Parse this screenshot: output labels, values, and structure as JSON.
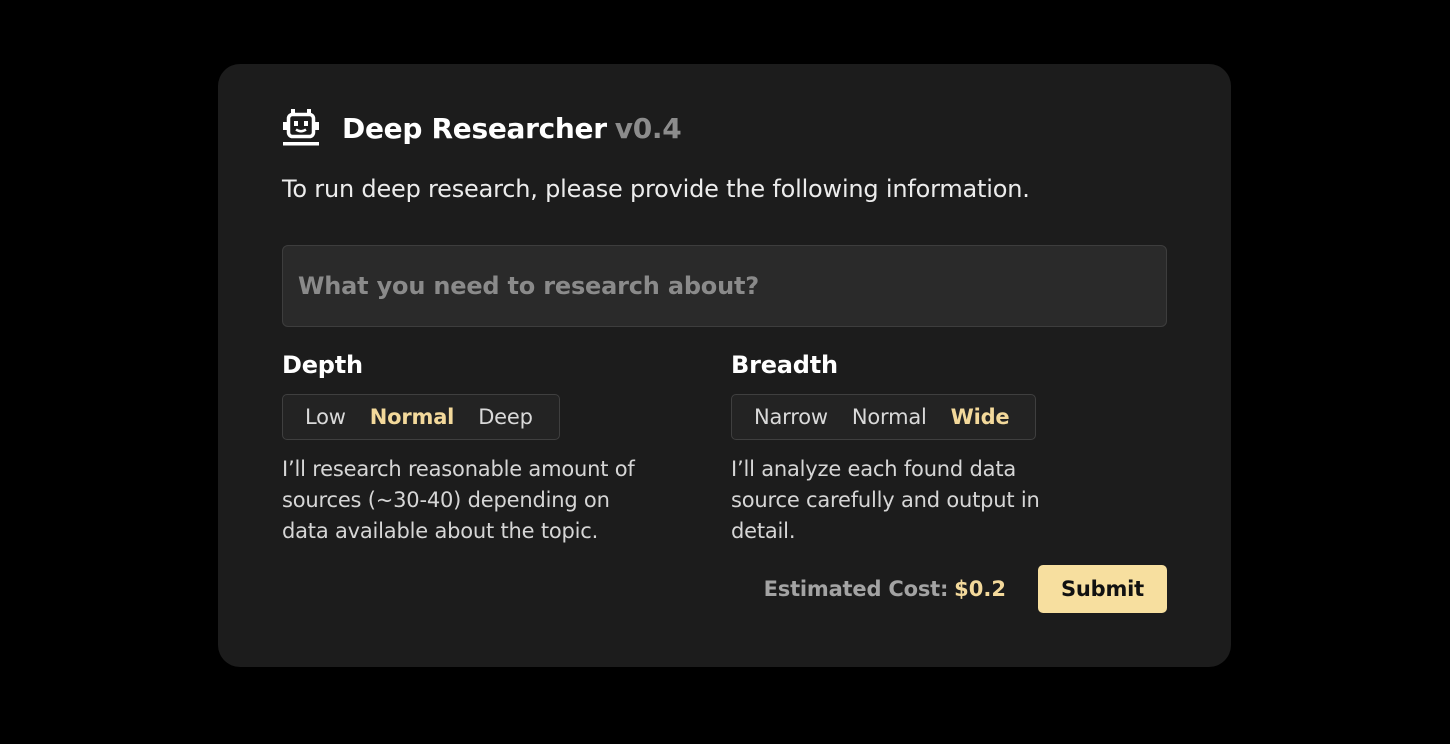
{
  "app": {
    "title": "Deep Researcher",
    "version": "v0.4",
    "icon": "robot-icon"
  },
  "intro": {
    "text": "To run deep research, please provide the following information."
  },
  "topic": {
    "value": "",
    "placeholder": "What you need to research about?"
  },
  "depth": {
    "label": "Depth",
    "options": [
      "Low",
      "Normal",
      "Deep"
    ],
    "selected": "Normal",
    "description": "I’ll research reasonable amount of sources (~30-40) depending on data available about the topic."
  },
  "breadth": {
    "label": "Breadth",
    "options": [
      "Narrow",
      "Normal",
      "Wide"
    ],
    "selected": "Wide",
    "description": "I’ll analyze each found data source carefully and output in detail."
  },
  "footer": {
    "cost_label": "Estimated Cost:",
    "cost_value": "$0.2",
    "submit_label": "Submit"
  },
  "colors": {
    "background": "#000000",
    "card": "#1c1c1c",
    "accent": "#f7df9f",
    "accent_text": "#f3d99b"
  }
}
